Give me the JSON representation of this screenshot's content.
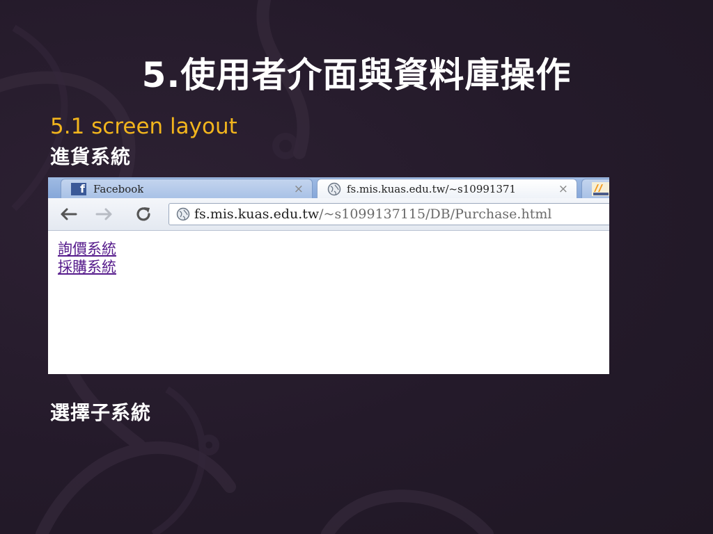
{
  "slide": {
    "title": "5.使用者介面與資料庫操作",
    "subtitle": "5.1 screen layout",
    "label_top": "進貨系統",
    "label_bottom": "選擇子系統"
  },
  "browser": {
    "tabs": [
      {
        "label": "Facebook",
        "icon": "facebook-icon",
        "state": "inactive"
      },
      {
        "label": "fs.mis.kuas.edu.tw/~s10991371",
        "icon": "globe-icon",
        "state": "active"
      },
      {
        "label": "",
        "icon": "phpmyadmin-icon",
        "state": "inactive-partial"
      }
    ],
    "tab_close_glyph": "×",
    "toolbar": {
      "back_icon": "back-arrow-icon",
      "forward_icon": "forward-arrow-icon",
      "reload_icon": "reload-icon"
    },
    "address": {
      "host": "fs.mis.kuas.edu.tw",
      "path": "/~s1099137115/DB/Purchase.html"
    },
    "links": [
      {
        "label": "詢價系統"
      },
      {
        "label": "採購系統"
      }
    ]
  },
  "colors": {
    "background": "#241a2a",
    "subtitle": "#f2b51d",
    "visited_link": "#551a8b",
    "facebook_blue": "#3b5998"
  }
}
